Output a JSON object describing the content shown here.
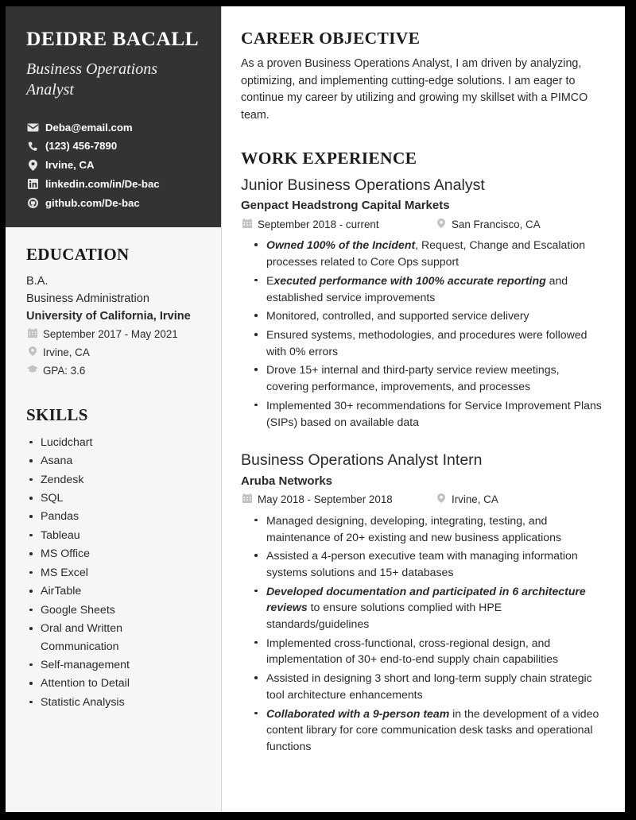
{
  "theme": {
    "sidebar_dark": "#333333",
    "sidebar_light": "#f6f6f6",
    "page_background": "#ffffff",
    "frame": "#000000",
    "text": "#2a2a2a",
    "heading": "#1b1b1b",
    "icon_muted": "#c2c2c2"
  },
  "sidebar": {
    "name": "DEIDRE BACALL",
    "title": "Business Operations Analyst",
    "contacts": [
      {
        "icon": "envelope-icon",
        "label": "Deba@email.com"
      },
      {
        "icon": "phone-icon",
        "label": "(123) 456-7890"
      },
      {
        "icon": "location-pin-icon",
        "label": "Irvine, CA"
      },
      {
        "icon": "linkedin-icon",
        "label": "linkedin.com/in/De-bac"
      },
      {
        "icon": "github-icon",
        "label": "github.com/De-bac"
      }
    ],
    "education": {
      "heading": "EDUCATION",
      "degree": "B.A.",
      "field": "Business Administration",
      "school": "University of California, Irvine",
      "dates": "September 2017 - May 2021",
      "location": "Irvine, CA",
      "gpa": "GPA: 3.6"
    },
    "skills": {
      "heading": "SKILLS",
      "items": [
        "Lucidchart",
        "Asana",
        "Zendesk",
        "SQL",
        "Pandas",
        "Tableau",
        "MS Office",
        "MS Excel",
        "AirTable",
        "Google Sheets",
        "Oral and Written Communication",
        "Self-management",
        "Attention to Detail",
        "Statistic Analysis"
      ]
    }
  },
  "main": {
    "objective": {
      "heading": "CAREER OBJECTIVE",
      "body": "As a proven Business Operations Analyst, I am driven by analyzing, optimizing, and implementing cutting-edge solutions. I am eager to continue my career by utilizing and growing my skillset with a PIMCO team."
    },
    "experience": {
      "heading": "WORK EXPERIENCE",
      "entries": [
        {
          "title": "Junior Business Operations Analyst",
          "company": "Genpact Headstrong Capital Markets",
          "dates": "September 2018 - current",
          "location": "San Francisco, CA",
          "bullets": [
            {
              "emphasis": "Owned 100% of the Incident",
              "rest": ", Request, Change and Escalation processes related to Core Ops support",
              "lead": ""
            },
            {
              "lead": "E",
              "emphasis": "xecuted performance with 100% accurate reporting",
              "rest": " and established service improvements"
            },
            {
              "lead": "",
              "emphasis": "",
              "rest": "Monitored, controlled, and supported service delivery"
            },
            {
              "lead": "",
              "emphasis": "",
              "rest": "Ensured systems, methodologies, and procedures were followed with 0% errors"
            },
            {
              "lead": "",
              "emphasis": "",
              "rest": "Drove 15+ internal and third-party service review meetings, covering performance, improvements, and processes"
            },
            {
              "lead": "",
              "emphasis": "",
              "rest": "Implemented 30+ recommendations for Service Improvement Plans (SIPs) based on available data"
            }
          ]
        },
        {
          "title": "Business Operations Analyst Intern",
          "company": "Aruba Networks",
          "dates": "May 2018 - September 2018",
          "location": "Irvine, CA",
          "bullets": [
            {
              "lead": "",
              "emphasis": "",
              "rest": "Managed designing, developing, integrating, testing, and maintenance of 20+ existing and new business applications"
            },
            {
              "lead": "",
              "emphasis": "",
              "rest": "Assisted a 4-person executive team with managing information systems solutions and 15+ databases"
            },
            {
              "lead": "",
              "emphasis": "Developed documentation and participated in 6 architecture reviews",
              "rest": " to ensure solutions complied with HPE standards/guidelines"
            },
            {
              "lead": "",
              "emphasis": "",
              "rest": "Implemented cross-functional, cross-regional design, and implementation of 30+ end-to-end supply chain capabilities"
            },
            {
              "lead": "",
              "emphasis": "",
              "rest": "Assisted in designing 3 short and long-term supply chain strategic tool architecture enhancements"
            },
            {
              "lead": "",
              "emphasis": "Collaborated with a 9-person team",
              "rest": " in the development of a video content library for core communication desk tasks and operational functions"
            }
          ]
        }
      ]
    }
  }
}
